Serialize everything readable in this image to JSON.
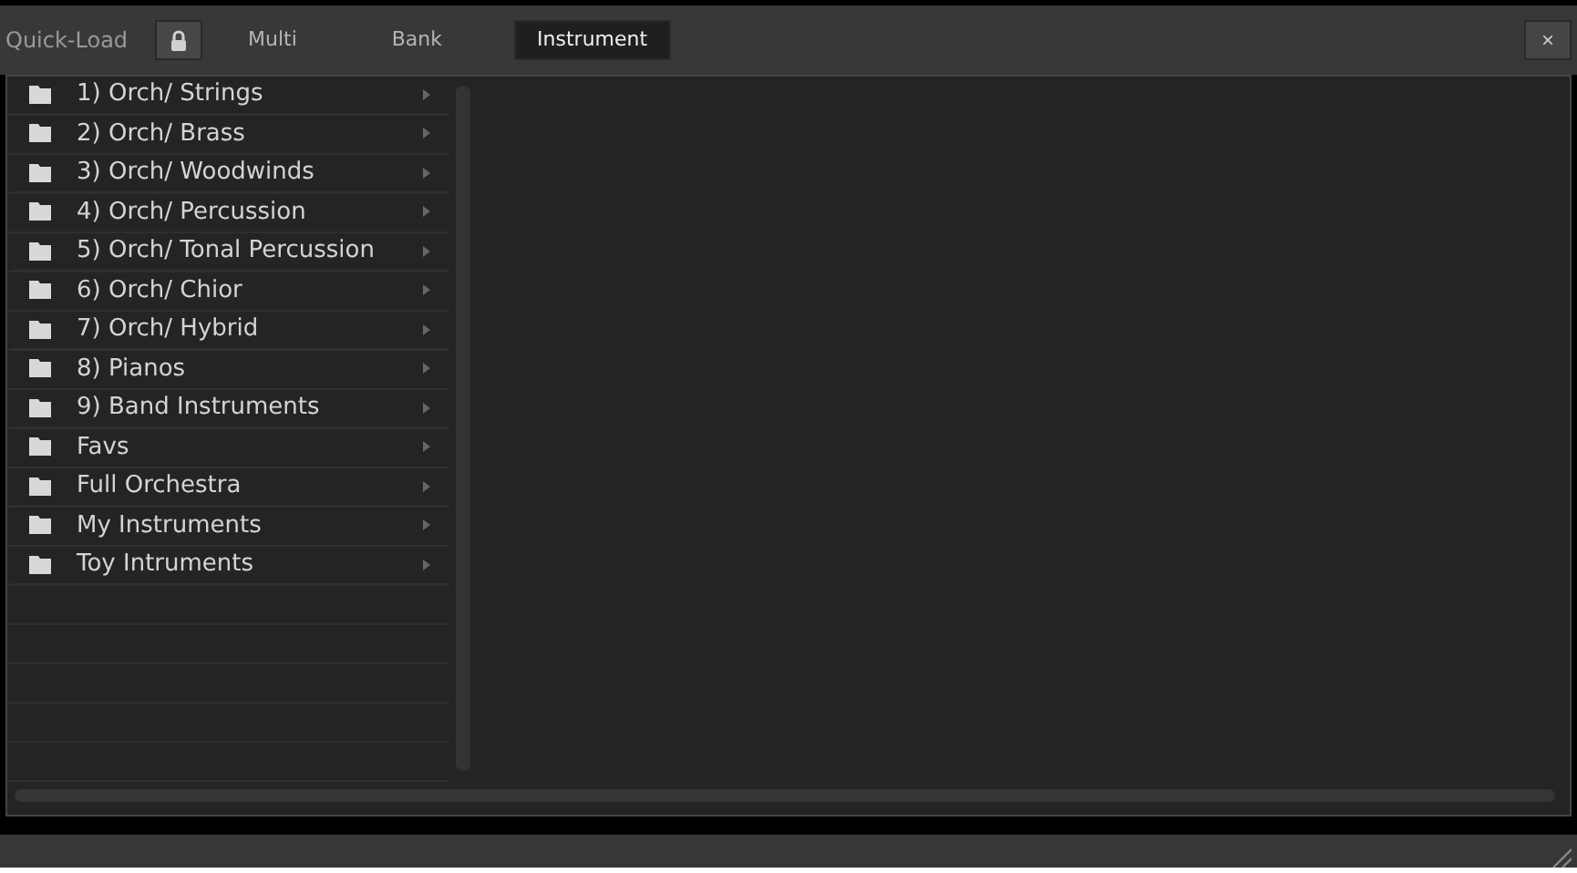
{
  "header": {
    "title": "Quick-Load",
    "locked": true,
    "close": "×"
  },
  "tabs": [
    {
      "label": "Multi",
      "selected": false
    },
    {
      "label": "Bank",
      "selected": false
    },
    {
      "label": "Instrument",
      "selected": true
    }
  ],
  "folders": [
    {
      "label": "1) Orch/ Strings"
    },
    {
      "label": "2) Orch/ Brass"
    },
    {
      "label": "3) Orch/ Woodwinds"
    },
    {
      "label": "4) Orch/ Percussion"
    },
    {
      "label": "5) Orch/ Tonal Percussion"
    },
    {
      "label": "6) Orch/ Chior"
    },
    {
      "label": "7) Orch/ Hybrid"
    },
    {
      "label": "8) Pianos"
    },
    {
      "label": "9) Band Instruments"
    },
    {
      "label": "Favs"
    },
    {
      "label": "Full Orchestra"
    },
    {
      "label": "My Instruments"
    },
    {
      "label": "Toy Intruments"
    }
  ]
}
